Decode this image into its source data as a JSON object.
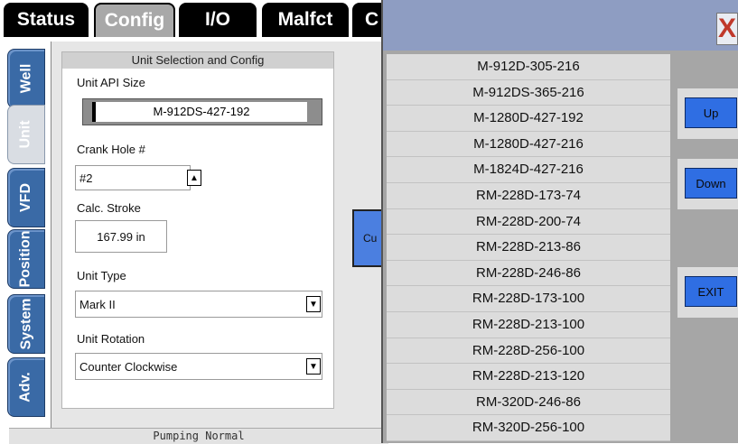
{
  "top_tabs": [
    "Status",
    "Config",
    "I/O",
    "Malfct",
    "C"
  ],
  "active_top_tab": "Config",
  "side_tabs": [
    "Well",
    "Unit",
    "VFD",
    "Position",
    "System",
    "Adv."
  ],
  "active_side_tab": "Unit",
  "panel": {
    "title": "Unit Selection and Config",
    "unit_api_size_label": "Unit API Size",
    "unit_api_size_value": "M-912DS-427-192",
    "crank_hole_label": "Crank Hole #",
    "crank_hole_value": "#2",
    "calc_stroke_label": "Calc. Stroke",
    "calc_stroke_value": "167.99 in",
    "unit_type_label": "Unit Type",
    "unit_type_value": "Mark II",
    "unit_rotation_label": "Unit Rotation",
    "unit_rotation_value": "Counter Clockwise"
  },
  "partial_button_label": "Cu",
  "status_bar": "Pumping Normal",
  "popup": {
    "close_glyph": "X",
    "items": [
      "M-912D-305-216",
      "M-912DS-365-216",
      "M-1280D-427-192",
      "M-1280D-427-216",
      "M-1824D-427-216",
      "RM-228D-173-74",
      "RM-228D-200-74",
      "RM-228D-213-86",
      "RM-228D-246-86",
      "RM-228D-173-100",
      "RM-228D-213-100",
      "RM-228D-256-100",
      "RM-228D-213-120",
      "RM-320D-246-86",
      "RM-320D-256-100"
    ],
    "up_label": "Up",
    "down_label": "Down",
    "exit_label": "EXIT"
  },
  "icons": {
    "dropdown": "triangle-down",
    "spinner": "triangle-up"
  }
}
